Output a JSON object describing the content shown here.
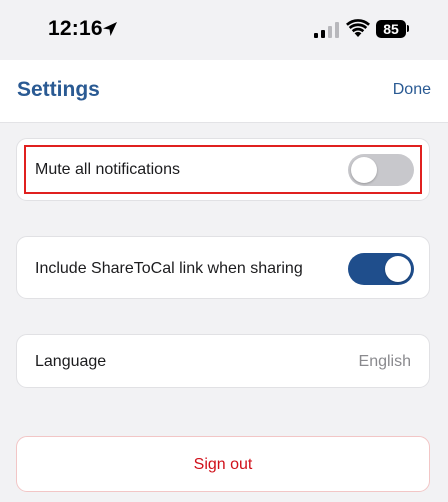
{
  "status_bar": {
    "time": "12:16",
    "battery": "85"
  },
  "nav": {
    "title": "Settings",
    "done_label": "Done"
  },
  "settings": {
    "mute_notifications": {
      "label": "Mute all notifications",
      "enabled": false
    },
    "include_link": {
      "label": "Include ShareToCal link when sharing",
      "enabled": true
    },
    "language": {
      "label": "Language",
      "value": "English"
    }
  },
  "sign_out": {
    "label": "Sign out"
  },
  "colors": {
    "accent": "#2a5a93",
    "toggle_on": "#1f4e8c",
    "toggle_off": "#c8c8cc",
    "danger": "#d0101a",
    "highlight": "#e0201f"
  }
}
